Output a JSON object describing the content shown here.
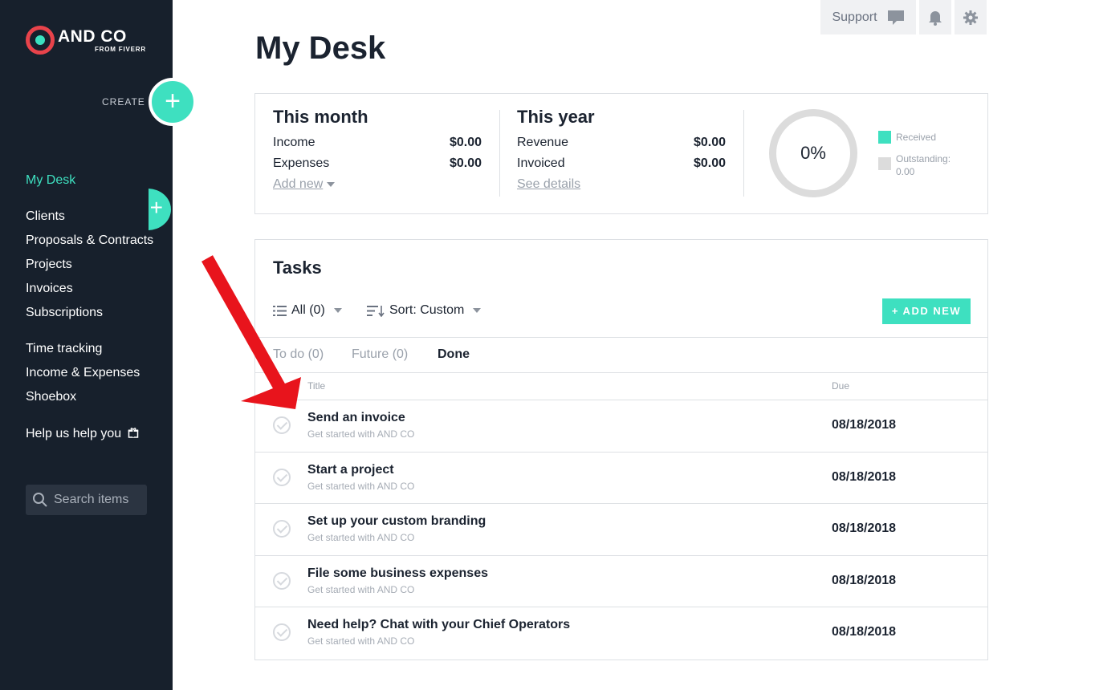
{
  "brand": {
    "name": "AND CO",
    "sub": "FROM FIVERR"
  },
  "sidebar": {
    "create_label": "CREATE",
    "nav": [
      {
        "label": "My Desk"
      },
      {
        "label": "Clients"
      },
      {
        "label": "Proposals & Contracts"
      },
      {
        "label": "Projects"
      },
      {
        "label": "Invoices"
      },
      {
        "label": "Subscriptions"
      },
      {
        "label": "Time tracking"
      },
      {
        "label": "Income & Expenses"
      },
      {
        "label": "Shoebox"
      },
      {
        "label": "Help us help you"
      }
    ],
    "search_placeholder": "Search items"
  },
  "topbar": {
    "support": "Support"
  },
  "page": {
    "title": "My Desk"
  },
  "summary": {
    "month": {
      "title": "This month",
      "rows": [
        {
          "label": "Income",
          "value": "$0.00"
        },
        {
          "label": "Expenses",
          "value": "$0.00"
        }
      ],
      "link": "Add new"
    },
    "year": {
      "title": "This year",
      "rows": [
        {
          "label": "Revenue",
          "value": "$0.00"
        },
        {
          "label": "Invoiced",
          "value": "$0.00"
        }
      ],
      "link": "See details"
    },
    "donut": {
      "percent_label": "0%",
      "received_fraction": 0
    },
    "legend": [
      {
        "label": "Received",
        "color": "#3ee0c0"
      },
      {
        "label": "Outstanding:",
        "value": "0.00",
        "color": "#dcdcdc"
      }
    ]
  },
  "tasks": {
    "title": "Tasks",
    "filter_all": "All (0)",
    "sort": "Sort: Custom",
    "add_new": "+ ADD NEW",
    "tabs": [
      {
        "label": "To do (0)"
      },
      {
        "label": "Future (0)"
      },
      {
        "label": "Done"
      }
    ],
    "columns": {
      "title": "Title",
      "due": "Due"
    },
    "rows": [
      {
        "title": "Send an invoice",
        "subtitle": "Get started with AND CO",
        "due": "08/18/2018"
      },
      {
        "title": "Start a project",
        "subtitle": "Get started with AND CO",
        "due": "08/18/2018"
      },
      {
        "title": "Set up your custom branding",
        "subtitle": "Get started with AND CO",
        "due": "08/18/2018"
      },
      {
        "title": "File some business expenses",
        "subtitle": "Get started with AND CO",
        "due": "08/18/2018"
      },
      {
        "title": "Need help? Chat with your Chief Operators",
        "subtitle": "Get started with AND CO",
        "due": "08/18/2018"
      }
    ]
  },
  "colors": {
    "accent": "#3ee0c0",
    "sidebar_bg": "#17202c",
    "annotation_arrow": "#e8141c"
  },
  "icons": [
    "logo-mark",
    "plus-icon",
    "search-icon",
    "chat-bubble-icon",
    "bell-icon",
    "gear-icon",
    "list-icon",
    "sort-icon",
    "caret-down-icon",
    "check-circle-icon",
    "gift-icon"
  ]
}
